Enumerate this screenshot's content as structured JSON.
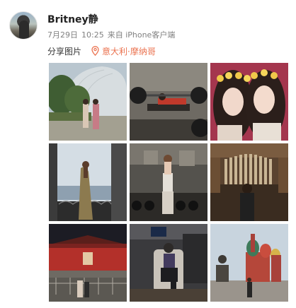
{
  "post": {
    "username": "Britney静",
    "date": "7月29日",
    "time": "10:25",
    "source": "来自 iPhone客户端",
    "share_label": "分享图片",
    "location_icon": "map-pin-icon",
    "location": "意大利·摩纳哥"
  },
  "colors": {
    "location": "#eb7350",
    "meta": "#808080",
    "username": "#222222"
  },
  "photos": [
    {
      "subject": "two women in front of a glass dome building with palm trees"
    },
    {
      "subject": "woman lifting weights on a bench in a gym"
    },
    {
      "subject": "selfie of two women wearing flower crowns"
    },
    {
      "subject": "woman at a balcony overlooking the sea"
    },
    {
      "subject": "woman standing in a gym with dumbbells"
    },
    {
      "subject": "woman in front of a pipe organ"
    },
    {
      "subject": "woman at a red gate at night"
    },
    {
      "subject": "woman sitting in a private jet seat"
    },
    {
      "subject": "woman in front of an onion-domed cathedral"
    }
  ]
}
